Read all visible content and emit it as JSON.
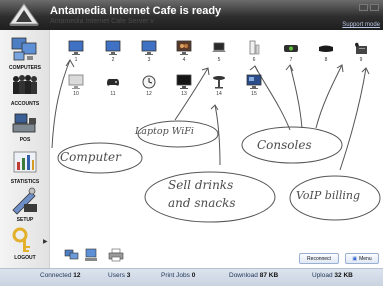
{
  "window": {
    "title": "Antamedia Internet Cafe is ready",
    "subtitle": "Antamedia Internet Cafe Server v",
    "support_link": "Support mode"
  },
  "sidebar": {
    "items": [
      {
        "label": "COMPUTERS",
        "icon": "computers-icon"
      },
      {
        "label": "ACCOUNTS",
        "icon": "accounts-icon"
      },
      {
        "label": "POS",
        "icon": "pos-icon"
      },
      {
        "label": "STATISTICS",
        "icon": "statistics-icon"
      },
      {
        "label": "SETUP",
        "icon": "setup-icon"
      },
      {
        "label": "LOGOUT",
        "icon": "logout-icon"
      }
    ]
  },
  "computers": [
    {
      "number": "1",
      "icon": "monitor-icon"
    },
    {
      "number": "2",
      "icon": "monitor-icon"
    },
    {
      "number": "3",
      "icon": "monitor-icon"
    },
    {
      "number": "4",
      "icon": "monitor-icon"
    },
    {
      "number": "5",
      "icon": "laptop-icon"
    },
    {
      "number": "6",
      "icon": "wii-console-icon"
    },
    {
      "number": "7",
      "icon": "xbox-console-icon"
    },
    {
      "number": "8",
      "icon": "playstation-console-icon"
    },
    {
      "number": "9",
      "icon": "voip-phone-icon"
    },
    {
      "number": "10",
      "icon": "monitor-icon"
    },
    {
      "number": "11",
      "icon": "gamepad-icon"
    },
    {
      "number": "12",
      "icon": "clock-icon"
    },
    {
      "number": "13",
      "icon": "monitor-icon"
    },
    {
      "number": "14",
      "icon": "bar-table-icon"
    },
    {
      "number": "15",
      "icon": "monitor-icon"
    }
  ],
  "annotations": {
    "laptop": "Laptop WiFi",
    "computer": "Computer",
    "consoles": "Consoles",
    "drinks_1": "Sell drinks",
    "drinks_2": "and snacks",
    "voip": "VoIP billing"
  },
  "actions": {
    "reconnect": "Reconnect",
    "menu": "Menu"
  },
  "status": {
    "connected_label": "Connected",
    "connected_value": "12",
    "users_label": "Users",
    "users_value": "3",
    "print_label": "Print Jobs",
    "print_value": "0",
    "download_label": "Download",
    "download_value": "87 KB",
    "upload_label": "Upload",
    "upload_value": "32 KB"
  }
}
